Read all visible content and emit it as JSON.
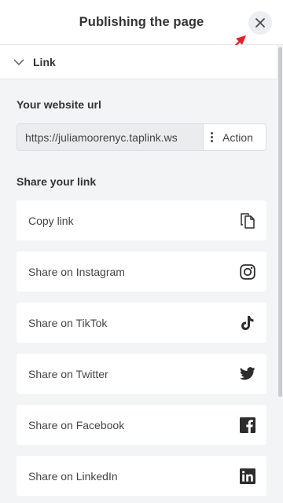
{
  "header": {
    "title": "Publishing the page"
  },
  "section": {
    "label": "Link"
  },
  "website": {
    "label": "Your website url",
    "url": "https://juliamoorenyc.taplink.ws",
    "action_label": "Action"
  },
  "share": {
    "label": "Share your link",
    "items": [
      {
        "label": "Copy link",
        "icon": "copy-icon"
      },
      {
        "label": "Share on Instagram",
        "icon": "instagram-icon"
      },
      {
        "label": "Share on TikTok",
        "icon": "tiktok-icon"
      },
      {
        "label": "Share on Twitter",
        "icon": "twitter-icon"
      },
      {
        "label": "Share on Facebook",
        "icon": "facebook-icon"
      },
      {
        "label": "Share on LinkedIn",
        "icon": "linkedin-icon"
      }
    ]
  },
  "colors": {
    "background": "#f3f4f6",
    "card": "#ffffff",
    "annotation_arrow": "#e8202a"
  }
}
